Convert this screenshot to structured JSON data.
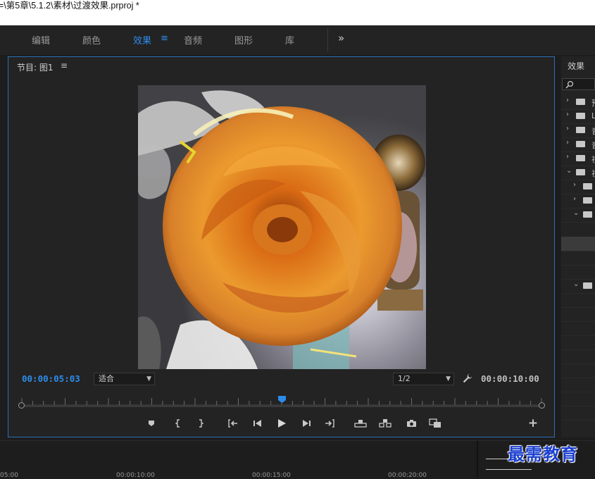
{
  "window": {
    "title": "=\\第5章\\5.1.2\\素材\\过渡效果.prproj *"
  },
  "workspaces": {
    "items": [
      {
        "label": "编辑",
        "active": false
      },
      {
        "label": "颜色",
        "active": false
      },
      {
        "label": "效果",
        "active": true
      },
      {
        "label": "音频",
        "active": false
      },
      {
        "label": "图形",
        "active": false
      },
      {
        "label": "库",
        "active": false
      }
    ],
    "menu_glyph": "≡",
    "more_glyph": "»"
  },
  "program_monitor": {
    "title": "节目: 图1",
    "menu_glyph": "≡",
    "current_time": "00:00:05:03",
    "duration": "00:00:10:00",
    "zoom_select": "适合",
    "resolution_select": "1/2",
    "playhead_position": 0.5,
    "transport": {
      "marker": "marker-icon",
      "mark_in": "mark-in-icon",
      "mark_out": "mark-out-icon",
      "go_to_in": "go-to-in-icon",
      "step_back": "step-back-icon",
      "play": "play-icon",
      "step_forward": "step-forward-icon",
      "go_to_out": "go-to-out-icon",
      "lift": "lift-icon",
      "extract": "extract-icon",
      "export_frame": "camera-icon",
      "compare": "compare-icon",
      "add": "+"
    }
  },
  "effects_panel": {
    "title": "效果",
    "rows": [
      {
        "expanded": false,
        "indent": 0,
        "text": "预"
      },
      {
        "expanded": false,
        "indent": 0,
        "text": "Lu"
      },
      {
        "expanded": false,
        "indent": 0,
        "text": "音"
      },
      {
        "expanded": false,
        "indent": 0,
        "text": "音"
      },
      {
        "expanded": false,
        "indent": 0,
        "text": "视"
      },
      {
        "expanded": true,
        "indent": 0,
        "text": "视"
      },
      {
        "expanded": false,
        "indent": 1,
        "text": ""
      },
      {
        "expanded": false,
        "indent": 1,
        "text": ""
      },
      {
        "expanded": true,
        "indent": 1,
        "text": ""
      }
    ]
  },
  "timeline": {
    "ticks": [
      "05:00",
      "00:00:10:00",
      "00:00:15:00",
      "00:00:20:00"
    ]
  },
  "watermark": {
    "text": "最需教育"
  }
}
